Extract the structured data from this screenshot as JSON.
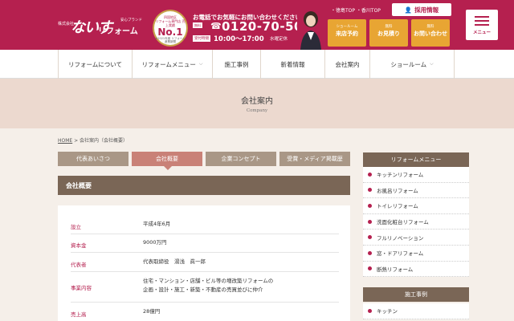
{
  "header": {
    "company_prefix": "株式会社",
    "logo_main": "ないす",
    "logo_sub": "リフォーム",
    "logo_tag": "安心ブランド",
    "award_line1": "四国地区",
    "award_line2": "リフォーム専門店 売上実績",
    "award_rank": "No.1",
    "award_note": "※2021年度 リフォーム産業新聞",
    "call_message": "お電話でお気軽にお問い合わせください!",
    "free_badge": "無料",
    "phone": "0120-70-5040",
    "hours_label": "受付時間",
    "hours": "10:00～17:00",
    "closed": "水曜定休",
    "top_links": "・徳島TOP ・香川TOP",
    "recruit_label": "採用情報",
    "cta": [
      {
        "small": "ショールーム",
        "main": "来店予約"
      },
      {
        "small": "無料",
        "main": "お見積り"
      },
      {
        "small": "無料",
        "main": "お問い合わせ"
      }
    ],
    "menu_label": "メニュー",
    "accent_color": "#b5204f"
  },
  "nav": [
    {
      "label": "リフォームについて",
      "dropdown": false
    },
    {
      "label": "リフォームメニュー",
      "dropdown": true
    },
    {
      "label": "施工事例",
      "dropdown": false
    },
    {
      "label": "新着情報",
      "dropdown": false
    },
    {
      "label": "会社案内",
      "dropdown": false
    },
    {
      "label": "ショールーム",
      "dropdown": true
    }
  ],
  "page_title": {
    "jp": "会社案内",
    "en": "Company"
  },
  "breadcrumb": {
    "home": "HOME",
    "rest": " > 会社案内（会社概要）"
  },
  "tabs": [
    {
      "label": "代表あいさつ",
      "active": false
    },
    {
      "label": "会社概要",
      "active": true
    },
    {
      "label": "企業コンセプト",
      "active": false
    },
    {
      "label": "受賞・メディア掲載歴",
      "active": false
    }
  ],
  "section_title": "会社概要",
  "company_info": [
    {
      "label": "設立",
      "value": "平成4年6月"
    },
    {
      "label": "資本金",
      "value": "9000万円"
    },
    {
      "label": "代表者",
      "value": "代表取締役　湯浅　眞一郎"
    },
    {
      "label": "事業内容",
      "value_line1": "住宅・マンション・店舗・ビル等の増改築リフォームの",
      "value_line2": "企画・設計・施工・新築・不動産の売買並びに仲介"
    },
    {
      "label": "売上高",
      "value": "28億円"
    }
  ],
  "sidebar": {
    "reform_menu_title": "リフォームメニュー",
    "reform_items": [
      "キッチンリフォーム",
      "お風呂リフォーム",
      "トイレリフォーム",
      "洗面化粧台リフォーム",
      "フルリノベーション",
      "窓・ドアリフォーム",
      "断熱リフォーム"
    ],
    "cases_title": "施工事例",
    "case_items": [
      "キッチン"
    ]
  }
}
